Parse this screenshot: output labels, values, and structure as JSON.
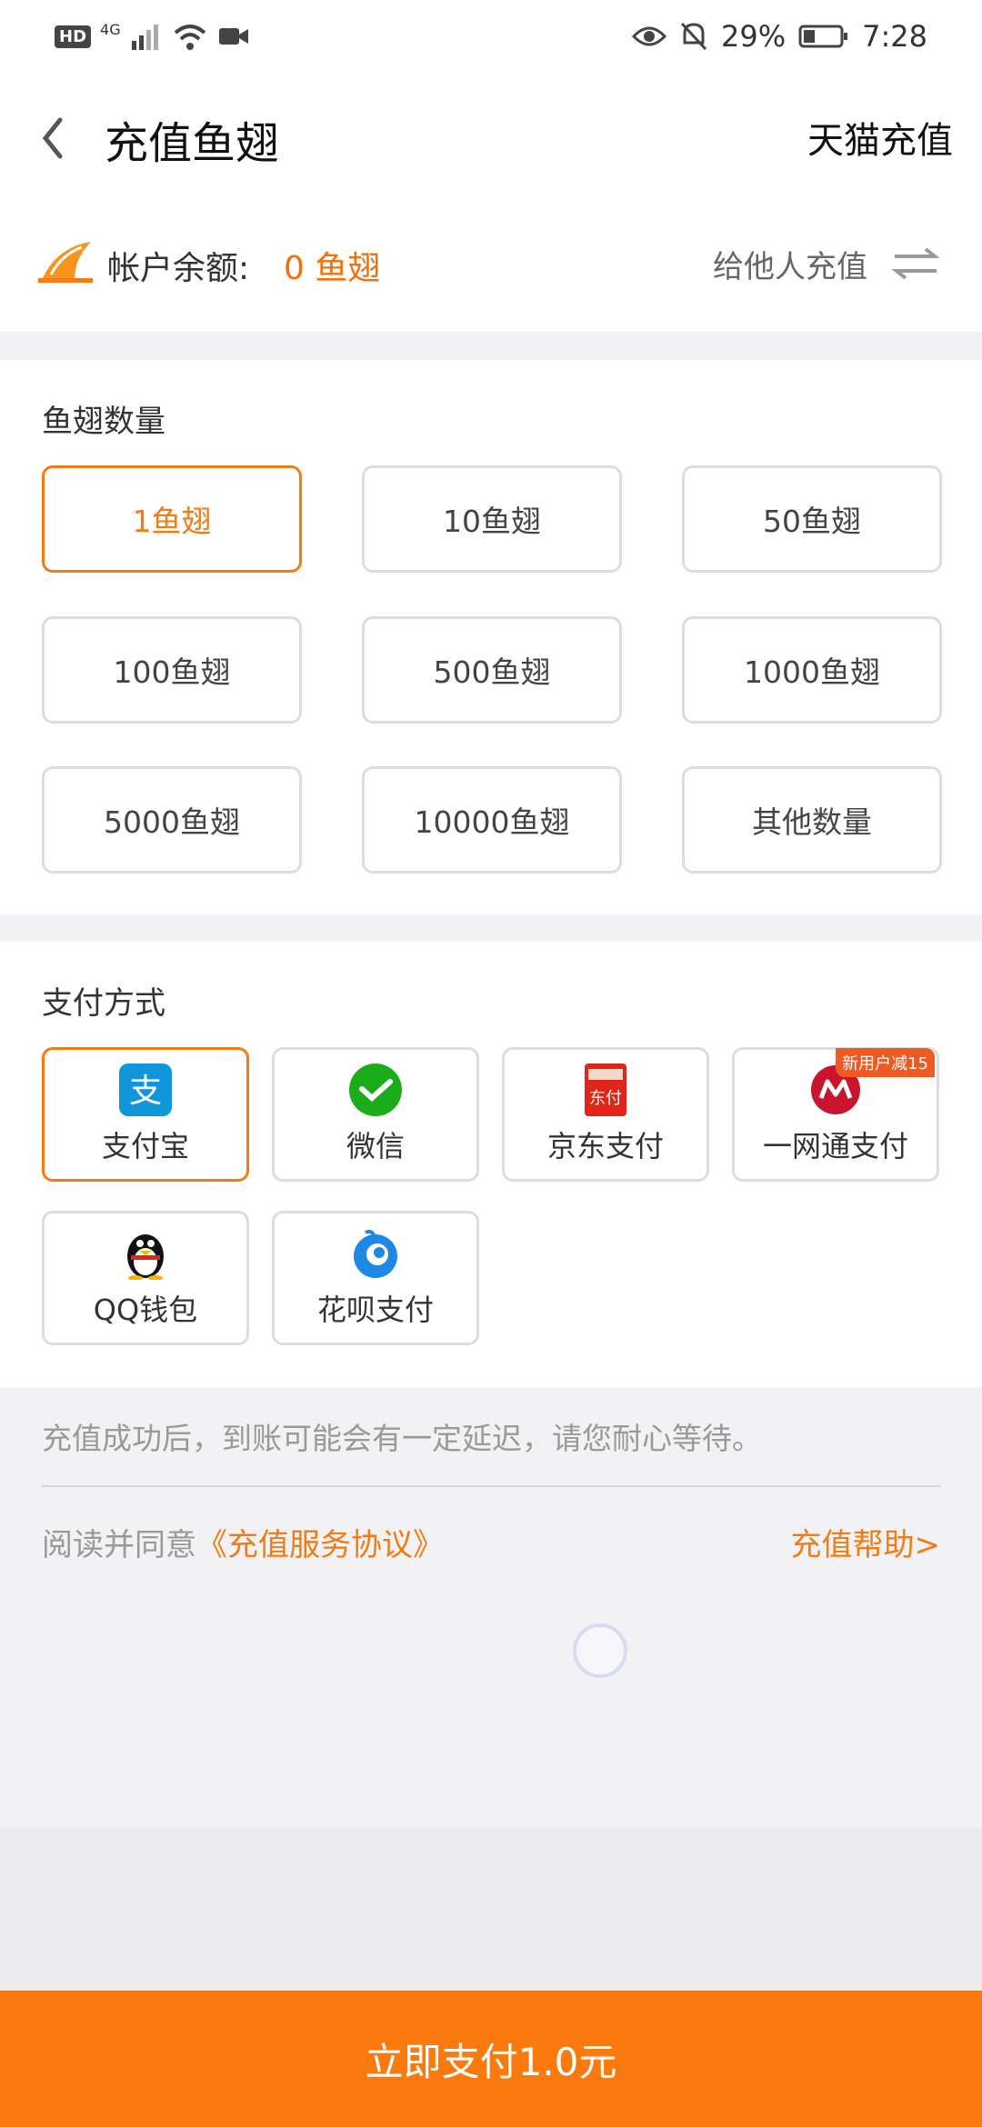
{
  "status_bar": {
    "hd": "HD",
    "network": "4G",
    "battery": "29%",
    "time": "7:28"
  },
  "nav": {
    "title": "充值鱼翅",
    "right_link": "天猫充值"
  },
  "balance": {
    "label": "帐户余额:",
    "value": "0 鱼翅",
    "gift_label": "给他人充值"
  },
  "amount_section": {
    "title": "鱼翅数量",
    "options": [
      "1鱼翅",
      "10鱼翅",
      "50鱼翅",
      "100鱼翅",
      "500鱼翅",
      "1000鱼翅",
      "5000鱼翅",
      "10000鱼翅",
      "其他数量"
    ],
    "selected": "1鱼翅"
  },
  "payment_section": {
    "title": "支付方式",
    "methods": [
      "支付宝",
      "微信",
      "京东支付",
      "一网通支付",
      "QQ钱包",
      "花呗支付"
    ],
    "selected": "支付宝",
    "promo_badge": "新用户减15"
  },
  "notice": "充值成功后，到账可能会有一定延迟，请您耐心等待。",
  "agreement": {
    "prefix": "阅读并同意",
    "link": "《充值服务协议》",
    "help": "充值帮助>"
  },
  "pay_button": "立即支付1.0元",
  "colors": {
    "accent": "#f47b14",
    "pay_bar": "#fb7a0d",
    "alipay": "#1296db",
    "wechat": "#1aad19",
    "jd": "#e1251b"
  }
}
